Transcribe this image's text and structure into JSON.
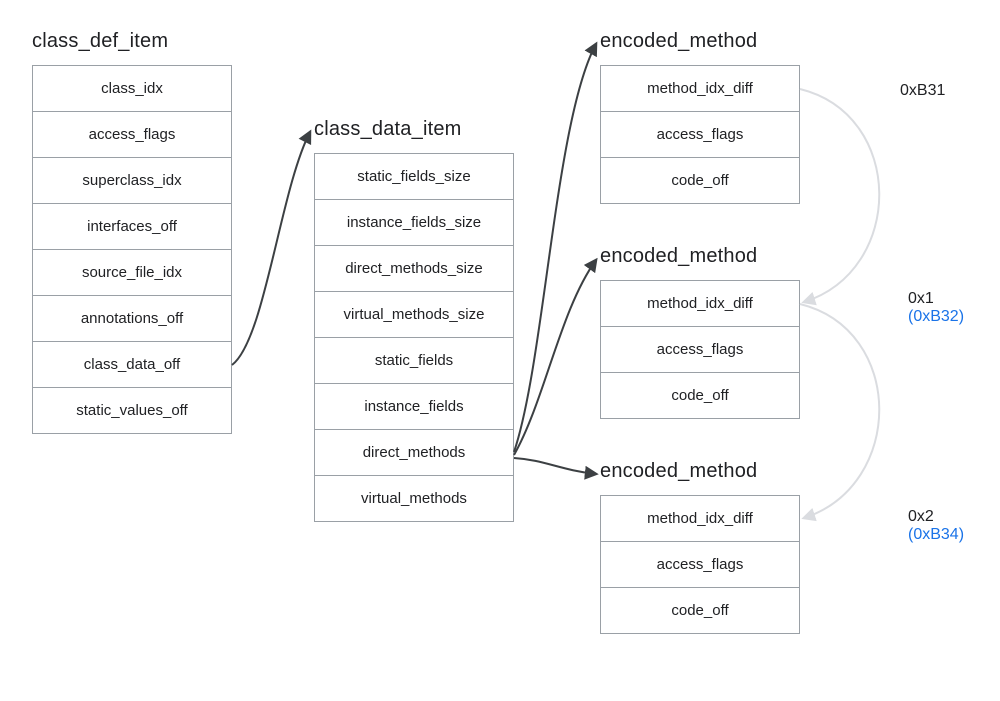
{
  "blocks": {
    "class_def_item": {
      "title": "class_def_item",
      "rows": [
        "class_idx",
        "access_flags",
        "superclass_idx",
        "interfaces_off",
        "source_file_idx",
        "annotations_off",
        "class_data_off",
        "static_values_off"
      ]
    },
    "class_data_item": {
      "title": "class_data_item",
      "rows": [
        "static_fields_size",
        "instance_fields_size",
        "direct_methods_size",
        "virtual_methods_size",
        "static_fields",
        "instance_fields",
        "direct_methods",
        "virtual_methods"
      ]
    },
    "encoded_method_1": {
      "title": "encoded_method",
      "rows": [
        "method_idx_diff",
        "access_flags",
        "code_off"
      ]
    },
    "encoded_method_2": {
      "title": "encoded_method",
      "rows": [
        "method_idx_diff",
        "access_flags",
        "code_off"
      ]
    },
    "encoded_method_3": {
      "title": "encoded_method",
      "rows": [
        "method_idx_diff",
        "access_flags",
        "code_off"
      ]
    }
  },
  "annotations": {
    "a1": {
      "line1": "0xB31"
    },
    "a2": {
      "line1": "0x1",
      "line2": "(0xB32)"
    },
    "a3": {
      "line1": "0x2",
      "line2": "(0xB34)"
    }
  }
}
